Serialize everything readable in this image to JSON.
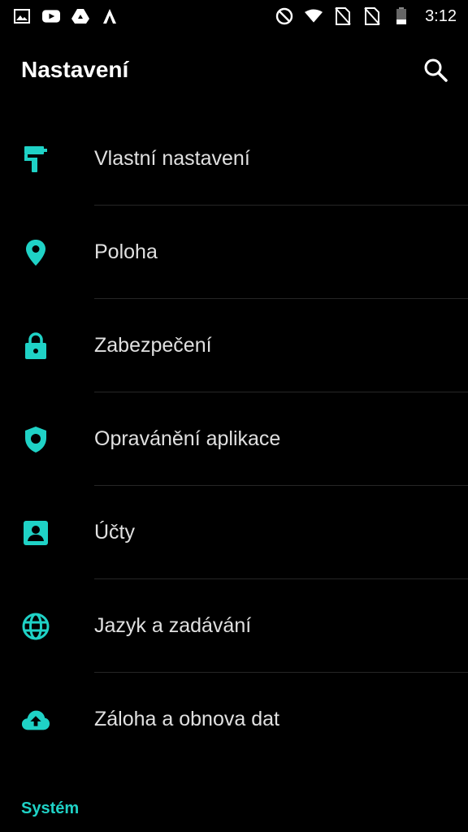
{
  "statusbar": {
    "time": "3:12",
    "left_icons": [
      "image-icon",
      "youtube-icon",
      "drive-icon",
      "autodesk-icon"
    ],
    "right_icons": [
      "do-not-disturb-icon",
      "wifi-icon",
      "no-sim-icon",
      "no-sim-icon",
      "battery-icon"
    ]
  },
  "toolbar": {
    "title": "Nastavení"
  },
  "items": [
    {
      "label": "Vlastní nastavení",
      "icon": "paint-roller-icon"
    },
    {
      "label": "Poloha",
      "icon": "location-pin-icon"
    },
    {
      "label": "Zabezpečení",
      "icon": "lock-icon"
    },
    {
      "label": "Opravánění aplikace",
      "icon": "shield-icon"
    },
    {
      "label": "Účty",
      "icon": "account-box-icon"
    },
    {
      "label": "Jazyk a zadávání",
      "icon": "globe-icon"
    },
    {
      "label": "Záloha a obnova dat",
      "icon": "cloud-upload-icon"
    }
  ],
  "section": {
    "title": "Systém"
  },
  "colors": {
    "accent": "#1fd2c6",
    "background": "#000000",
    "text": "#e0e0e0",
    "divider": "#262626"
  }
}
